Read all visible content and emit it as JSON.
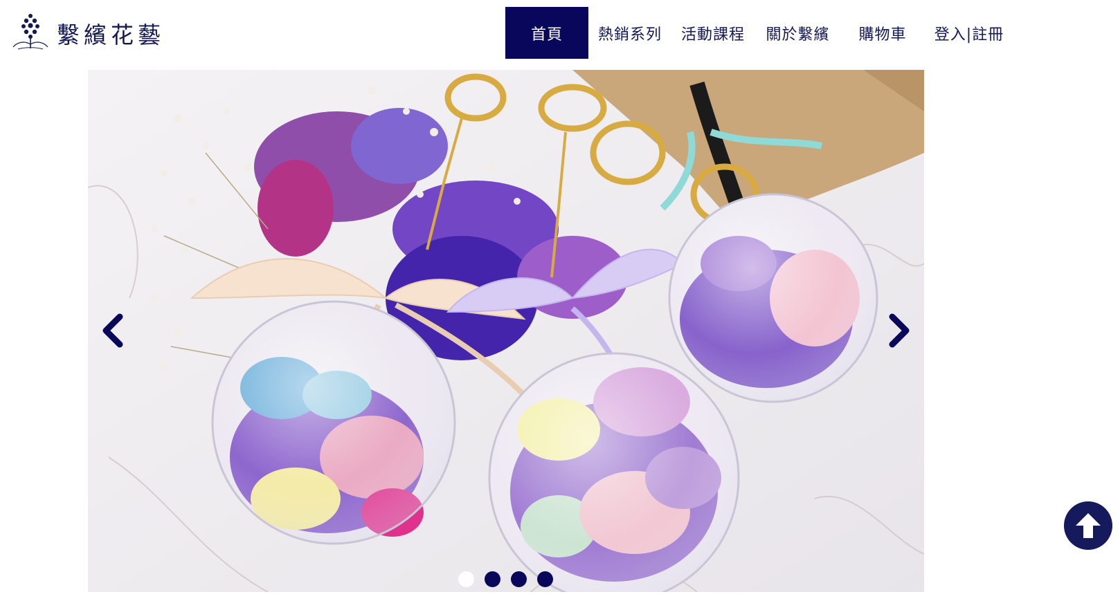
{
  "brand": {
    "name": "繫繽花藝"
  },
  "nav": {
    "items": [
      {
        "label": "首頁",
        "active": true
      },
      {
        "label": "熱銷系列"
      },
      {
        "label": "活動課程"
      },
      {
        "label": "關於繫繽"
      },
      {
        "label": "購物車"
      },
      {
        "label": "登入|註冊"
      }
    ]
  },
  "carousel": {
    "slide_count": 4,
    "active_index": 0
  },
  "colors": {
    "navy": "#08075c",
    "brand_text": "#141854",
    "white": "#ffffff"
  },
  "icons": {
    "prev": "chevron-left-icon",
    "next": "chevron-right-icon",
    "to_top": "arrow-up-icon"
  }
}
